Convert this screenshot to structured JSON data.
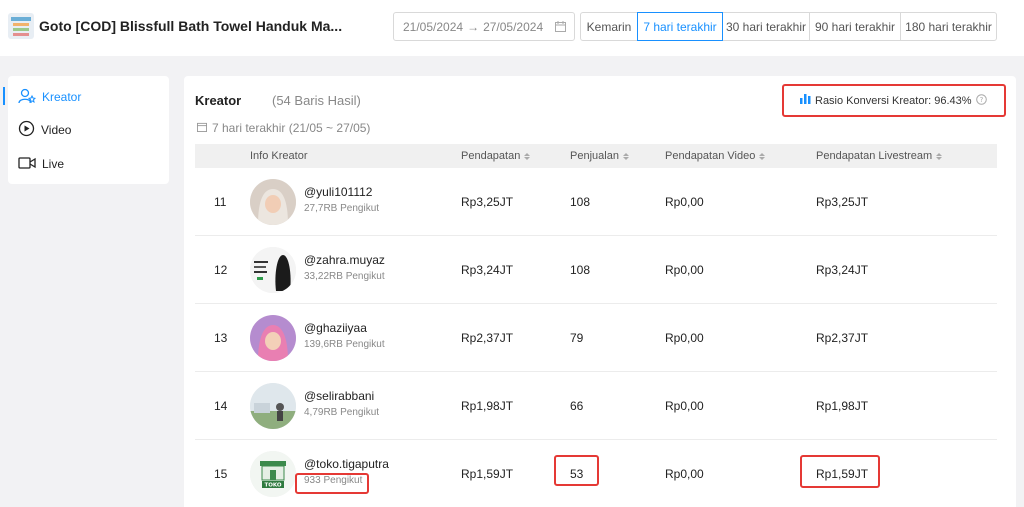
{
  "header": {
    "product_title": "Goto [COD] Blissfull Bath Towel Handuk Ma...",
    "date_start": "21/05/2024",
    "date_arrow": "→",
    "date_end": "27/05/2024",
    "periods": [
      {
        "label": "Kemarin",
        "active": false
      },
      {
        "label": "7 hari terakhir",
        "active": true
      },
      {
        "label": "30 hari terakhir",
        "active": false
      },
      {
        "label": "90 hari terakhir",
        "active": false
      },
      {
        "label": "180 hari terakhir",
        "active": false
      }
    ]
  },
  "sidebar": {
    "items": [
      {
        "label": "Kreator",
        "icon": "creator-icon",
        "active": true
      },
      {
        "label": "Video",
        "icon": "play-circle-icon",
        "active": false
      },
      {
        "label": "Live",
        "icon": "live-camera-icon",
        "active": false
      }
    ]
  },
  "main": {
    "title": "Kreator",
    "count": "(54 Baris Hasil)",
    "ratio_label": "Rasio Konversi Kreator: 96.43%",
    "period_label": "7 hari terakhir (21/05 ~ 27/05)",
    "columns": [
      "Info Kreator",
      "Pendapatan",
      "Penjualan",
      "Pendapatan Video",
      "Pendapatan Livestream"
    ],
    "rows": [
      {
        "rank": "11",
        "handle": "@yuli101112",
        "followers": "27,7RB Pengikut",
        "revenue": "Rp3,25JT",
        "sales": "108",
        "video_revenue": "Rp0,00",
        "live_revenue": "Rp3,25JT"
      },
      {
        "rank": "12",
        "handle": "@zahra.muyaz",
        "followers": "33,22RB Pengikut",
        "revenue": "Rp3,24JT",
        "sales": "108",
        "video_revenue": "Rp0,00",
        "live_revenue": "Rp3,24JT"
      },
      {
        "rank": "13",
        "handle": "@ghaziiyaa",
        "followers": "139,6RB Pengikut",
        "revenue": "Rp2,37JT",
        "sales": "79",
        "video_revenue": "Rp0,00",
        "live_revenue": "Rp2,37JT"
      },
      {
        "rank": "14",
        "handle": "@selirabbani",
        "followers": "4,79RB Pengikut",
        "revenue": "Rp1,98JT",
        "sales": "66",
        "video_revenue": "Rp0,00",
        "live_revenue": "Rp1,98JT"
      },
      {
        "rank": "15",
        "handle": "@toko.tigaputra",
        "followers": "933 Pengikut",
        "revenue": "Rp1,59JT",
        "sales": "53",
        "video_revenue": "Rp0,00",
        "live_revenue": "Rp1,59JT"
      }
    ],
    "toko_logo_text": "TOKO"
  },
  "colors": {
    "accent": "#1890ff",
    "highlight": "#e53935"
  }
}
